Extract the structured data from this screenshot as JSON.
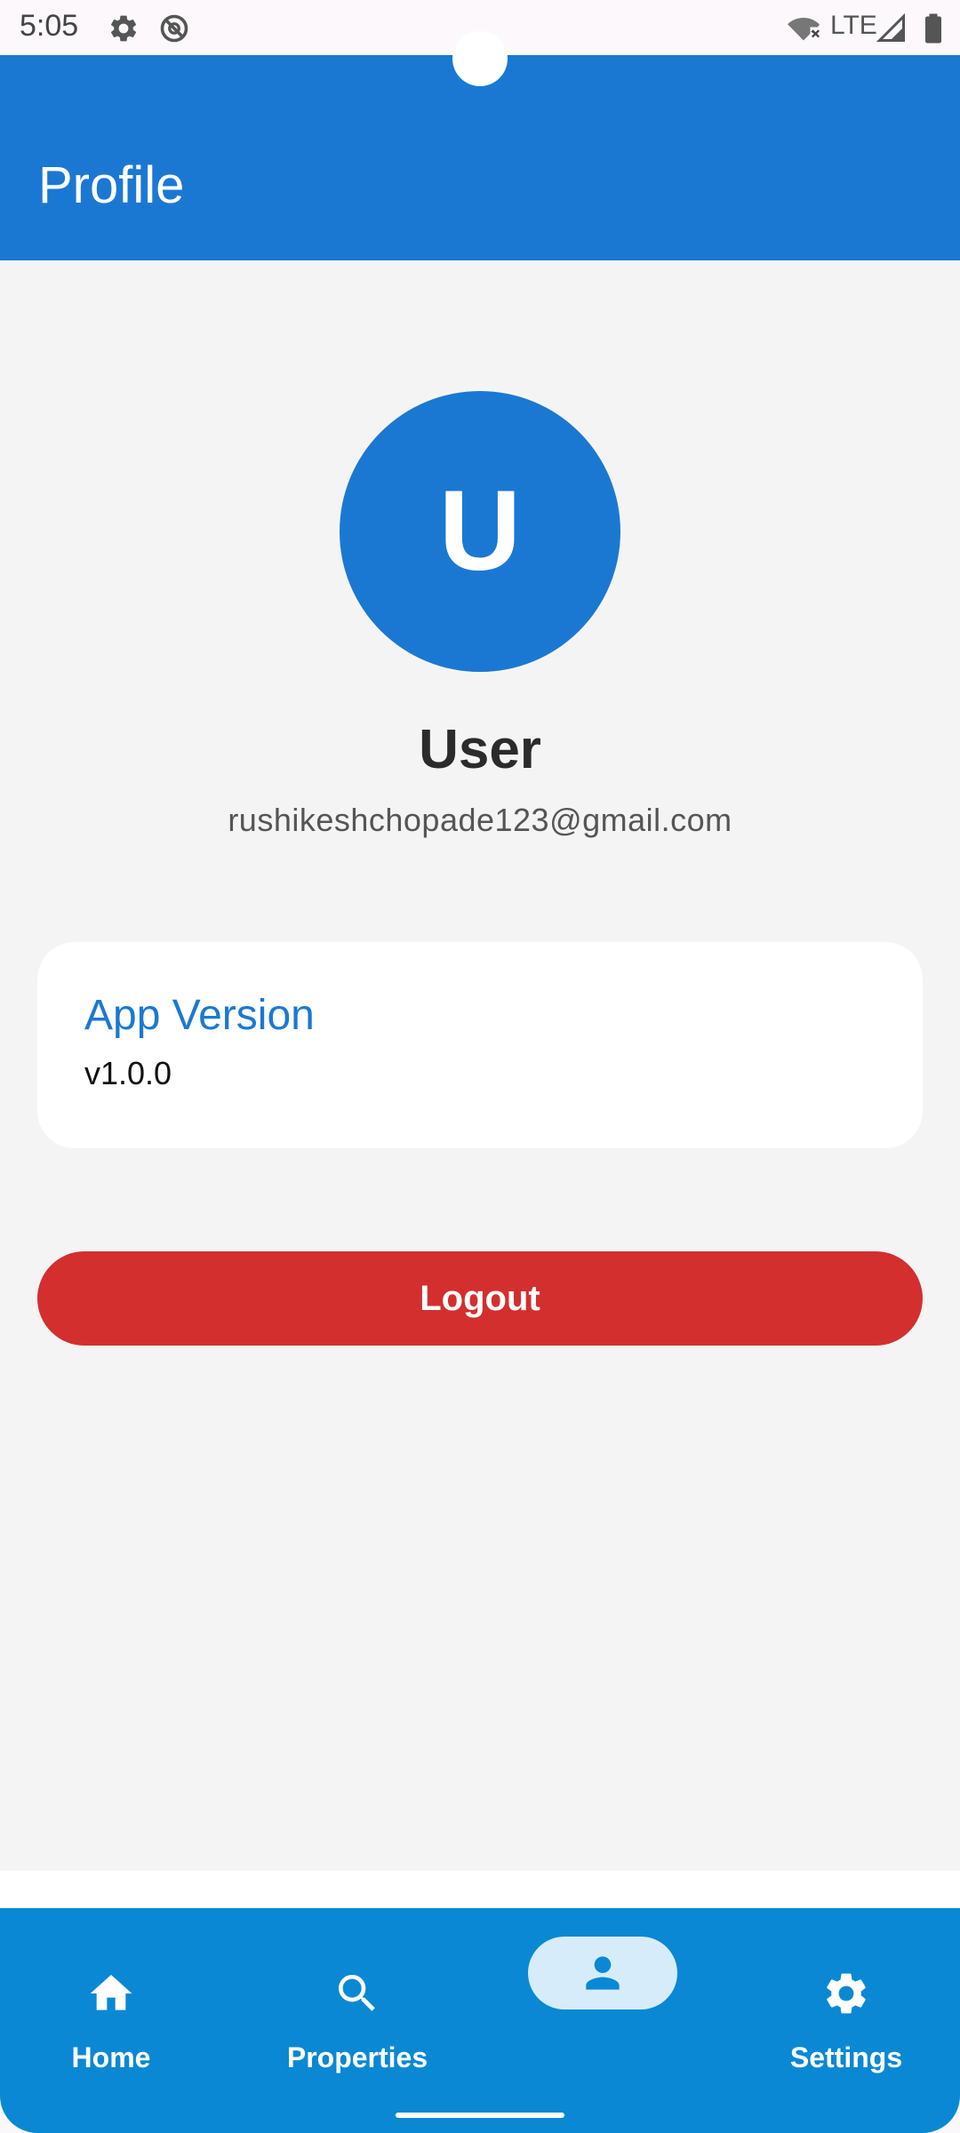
{
  "status_bar": {
    "time": "5:05",
    "network": "LTE",
    "icons": [
      "gear-icon",
      "no-disturb-icon",
      "wifi-off-icon",
      "signal-icon",
      "battery-icon"
    ]
  },
  "app_bar": {
    "title": "Profile"
  },
  "profile": {
    "avatar_initial": "U",
    "name": "User",
    "email": "rushikeshchopade123@gmail.com"
  },
  "version_card": {
    "label": "App Version",
    "value": "v1.0.0"
  },
  "logout": {
    "label": "Logout"
  },
  "bottom_nav": {
    "items": [
      {
        "label": "Home",
        "icon": "home-icon"
      },
      {
        "label": "Properties",
        "icon": "search-icon"
      },
      {
        "label": "",
        "icon": "person-icon",
        "selected": true
      },
      {
        "label": "Settings",
        "icon": "settings-icon"
      }
    ]
  },
  "colors": {
    "primary": "#1b78d2",
    "nav_bar": "#0a88d4",
    "logout": "#d32f2f",
    "background": "#f4f4f4"
  }
}
